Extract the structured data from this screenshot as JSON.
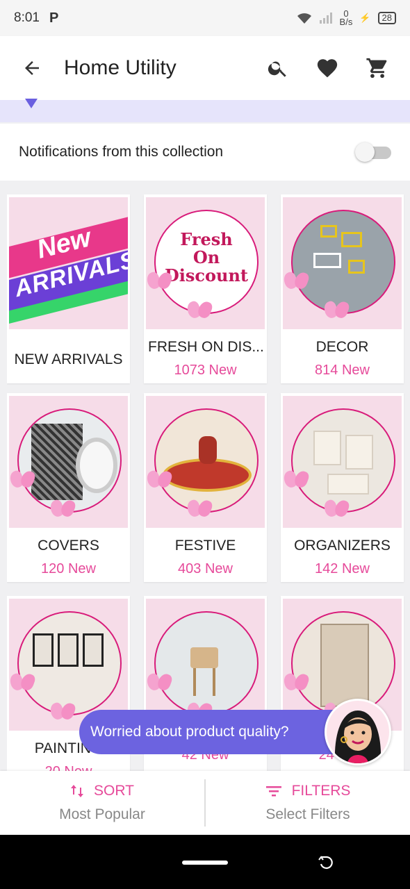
{
  "status": {
    "time": "8:01",
    "carrier_icon": "P",
    "net_speed_top": "0",
    "net_speed_unit": "B/s",
    "battery": "28"
  },
  "appbar": {
    "title": "Home Utility"
  },
  "notifications": {
    "label": "Notifications from this collection"
  },
  "grid": {
    "items": [
      {
        "name": "NEW ARRIVALS",
        "count": ""
      },
      {
        "name": "FRESH ON DIS...",
        "count": "1073 New"
      },
      {
        "name": "DECOR",
        "count": "814 New"
      },
      {
        "name": "COVERS",
        "count": "120 New"
      },
      {
        "name": "FESTIVE",
        "count": "403 New"
      },
      {
        "name": "ORGANIZERS",
        "count": "142 New"
      },
      {
        "name": "PAINTING",
        "count": "20 New"
      },
      {
        "name": "",
        "count": "42 New"
      },
      {
        "name": "",
        "count": "24 New"
      }
    ],
    "new_arrivals_art": {
      "line1": "New",
      "line2": "ARRIVALS"
    },
    "fresh_art": {
      "line1": "Fresh",
      "line2": "On",
      "line3": "Discount"
    }
  },
  "bubble": {
    "text": "Worried about product quality?"
  },
  "bottom": {
    "sort_label": "SORT",
    "sort_value": "Most Popular",
    "filters_label": "FILTERS",
    "filters_value": "Select Filters"
  },
  "colors": {
    "accent": "#e64a9a",
    "bubble": "#6c63e0",
    "card_bg": "#f6dce8"
  }
}
